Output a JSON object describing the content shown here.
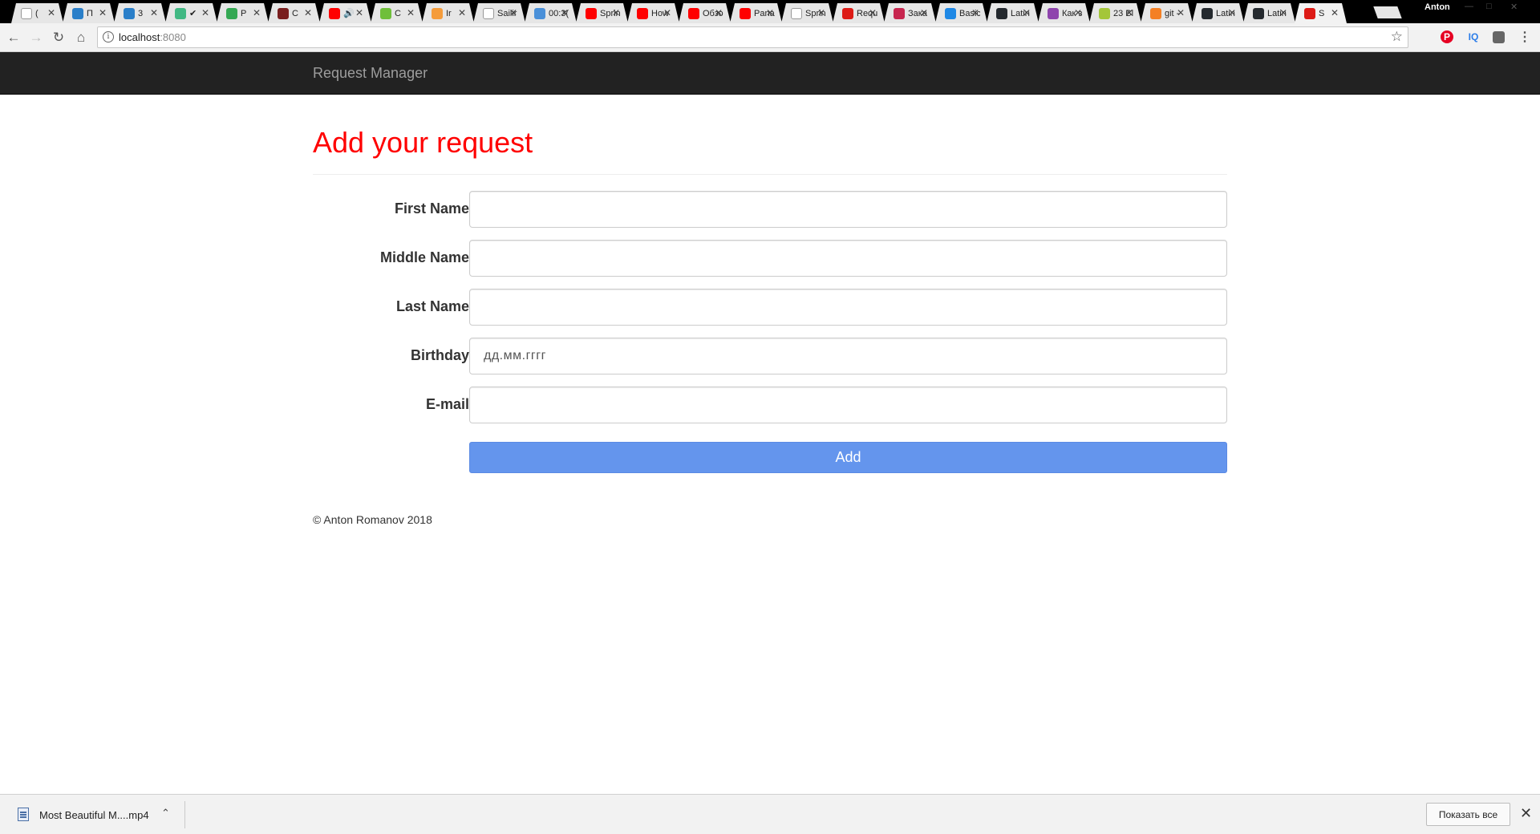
{
  "browser": {
    "tabs": [
      {
        "label": "(",
        "favicon": "page-icon",
        "color": "#ffffff"
      },
      {
        "label": "П",
        "favicon": "mail-at-icon",
        "color": "#2a7fc9"
      },
      {
        "label": "3",
        "favicon": "mail-at-icon",
        "color": "#2a7fc9"
      },
      {
        "label": "✔",
        "favicon": "vue-icon",
        "color": "#41b883"
      },
      {
        "label": "P",
        "favicon": "maps-icon",
        "color": "#34a853"
      },
      {
        "label": "C",
        "favicon": "terminal-icon",
        "color": "#7a1f1f"
      },
      {
        "label": "🔊",
        "favicon": "youtube-icon",
        "color": "#ff0000"
      },
      {
        "label": "C",
        "favicon": "download-icon",
        "color": "#6fbf3a"
      },
      {
        "label": "Ir",
        "favicon": "orange-icon",
        "color": "#f59c3b"
      },
      {
        "label": "Sailir",
        "favicon": "sail-icon",
        "color": "#ffffff"
      },
      {
        "label": "00:3(",
        "favicon": "clock-icon",
        "color": "#4a90d9"
      },
      {
        "label": "Sprin",
        "favicon": "youtube-icon",
        "color": "#ff0000"
      },
      {
        "label": "How",
        "favicon": "youtube-icon",
        "color": "#ff0000"
      },
      {
        "label": "Обзо",
        "favicon": "youtube-icon",
        "color": "#ff0000"
      },
      {
        "label": "Pana",
        "favicon": "youtube-icon",
        "color": "#ff0000"
      },
      {
        "label": "Sprin",
        "favicon": "page-icon",
        "color": "#ffffff"
      },
      {
        "label": "Requ",
        "favicon": "angular-icon",
        "color": "#dd1b16"
      },
      {
        "label": "Зака",
        "favicon": "grid-icon",
        "color": "#c7254e"
      },
      {
        "label": "Basic",
        "favicon": "bolt-icon",
        "color": "#1e88e5"
      },
      {
        "label": "Latin",
        "favicon": "github-icon",
        "color": "#24292e"
      },
      {
        "label": "Как з",
        "favicon": "pinwheel-icon",
        "color": "#8e44ad"
      },
      {
        "label": "23 Bl",
        "favicon": "android-icon",
        "color": "#a4c639"
      },
      {
        "label": "git -",
        "favicon": "stack-icon",
        "color": "#f48024"
      },
      {
        "label": "Latin",
        "favicon": "github-icon",
        "color": "#24292e"
      },
      {
        "label": "Latin",
        "favicon": "github-icon",
        "color": "#24292e"
      },
      {
        "label": "S",
        "favicon": "angular-icon",
        "color": "#dd1b16"
      }
    ],
    "profile_name": "Anton",
    "url_host": "localhost",
    "url_port": ":8080"
  },
  "navbar": {
    "brand": "Request Manager"
  },
  "form": {
    "title": "Add your request",
    "fields": [
      {
        "label": "First Name",
        "placeholder": "",
        "value": ""
      },
      {
        "label": "Middle Name",
        "placeholder": "",
        "value": ""
      },
      {
        "label": "Last Name",
        "placeholder": "",
        "value": ""
      },
      {
        "label": "Birthday",
        "placeholder": "дд.мм.гггг",
        "value": ""
      },
      {
        "label": "E-mail",
        "placeholder": "",
        "value": ""
      }
    ],
    "submit_label": "Add"
  },
  "footer": {
    "copyright": "© Anton Romanov 2018"
  },
  "downloads": {
    "file_name": "Most Beautiful M....mp4",
    "show_all_label": "Показать все"
  },
  "colors": {
    "title": "#ff0000",
    "navbar_bg": "#222222",
    "button_bg": "#6495ed"
  }
}
